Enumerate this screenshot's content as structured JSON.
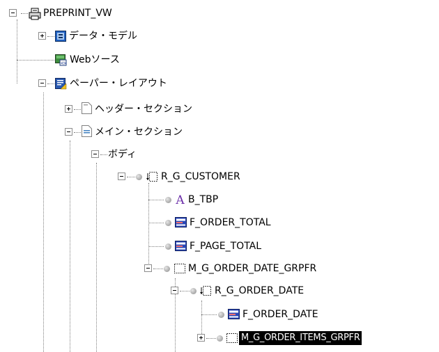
{
  "tree": {
    "root": {
      "label": "PREPRINT_VW",
      "icon": "report-icon"
    },
    "data_model": {
      "label": "データ・モデル",
      "icon": "data-model-icon"
    },
    "web_source": {
      "label": "Webソース",
      "icon": "web-source-icon"
    },
    "paper_layout": {
      "label": "ペーパー・レイアウト",
      "icon": "paper-layout-icon"
    },
    "header_section": {
      "label": "ヘッダー・セクション",
      "icon": "section-icon"
    },
    "main_section": {
      "label": "メイン・セクション",
      "icon": "section-icon"
    },
    "body": {
      "label": "ボディ"
    },
    "r_g_customer": {
      "label": "R_G_CUSTOMER",
      "icon": "repeating-frame-icon"
    },
    "b_tbp": {
      "label": "B_TBP",
      "icon": "text-boilerplate-icon"
    },
    "f_order_total": {
      "label": "F_ORDER_TOTAL",
      "icon": "field-icon"
    },
    "f_page_total": {
      "label": "F_PAGE_TOTAL",
      "icon": "field-icon"
    },
    "m_g_order_date_grpfr": {
      "label": "M_G_ORDER_DATE_GRPFR",
      "icon": "frame-icon"
    },
    "r_g_order_date": {
      "label": "R_G_ORDER_DATE",
      "icon": "repeating-frame-icon"
    },
    "f_order_date": {
      "label": "F_ORDER_DATE",
      "icon": "field-icon"
    },
    "m_g_order_items_grpfr": {
      "label": "M_G_ORDER_ITEMS_GRPFR",
      "icon": "frame-icon",
      "selected": true
    }
  },
  "colors": {
    "selection_background": "#000000",
    "selection_text": "#ffffff",
    "connector_line": "#7f7f7f",
    "boilerplate_a": "#6a2ca8",
    "field_icon": "#2b48b8"
  }
}
